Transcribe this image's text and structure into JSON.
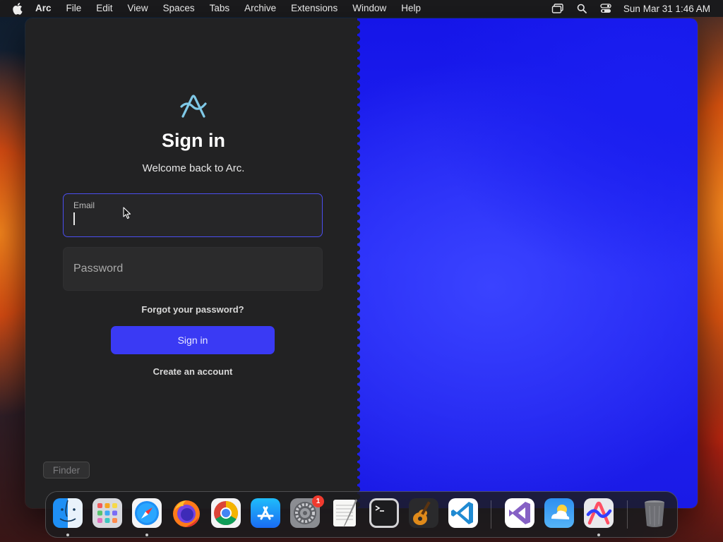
{
  "menubar": {
    "app_name": "Arc",
    "items": [
      "File",
      "Edit",
      "View",
      "Spaces",
      "Tabs",
      "Archive",
      "Extensions",
      "Window",
      "Help"
    ],
    "clock": "Sun Mar 31  1:46 AM",
    "tray_icons": [
      "screen-mirroring-icon",
      "spotlight-search-icon",
      "control-center-icon"
    ]
  },
  "signin": {
    "title": "Sign in",
    "subtitle": "Welcome back to Arc.",
    "email_label": "Email",
    "email_value": "",
    "password_placeholder": "Password",
    "forgot_link": "Forgot your password?",
    "submit_label": "Sign in",
    "create_link": "Create an account"
  },
  "tooltip": {
    "text": "Finder"
  },
  "dock": {
    "apps": [
      {
        "name": "Finder",
        "icon": "finder-icon",
        "running": true
      },
      {
        "name": "Launchpad",
        "icon": "launchpad-icon",
        "running": false
      },
      {
        "name": "Safari",
        "icon": "safari-icon",
        "running": true
      },
      {
        "name": "Firefox",
        "icon": "firefox-icon",
        "running": false
      },
      {
        "name": "Google Chrome",
        "icon": "chrome-icon",
        "running": false
      },
      {
        "name": "App Store",
        "icon": "app-store-icon",
        "running": false
      },
      {
        "name": "System Settings",
        "icon": "system-settings-icon",
        "running": false,
        "badge": "1"
      },
      {
        "name": "TextEdit",
        "icon": "textedit-icon",
        "running": false
      },
      {
        "name": "Terminal",
        "icon": "terminal-icon",
        "running": false
      },
      {
        "name": "GarageBand",
        "icon": "garageband-icon",
        "running": false
      },
      {
        "name": "Visual Studio Code",
        "icon": "vscode-icon",
        "running": false
      },
      {
        "name": "Visual Studio",
        "icon": "visual-studio-icon",
        "running": false
      },
      {
        "name": "Weather",
        "icon": "weather-icon",
        "running": false
      },
      {
        "name": "Arc",
        "icon": "arc-icon",
        "running": true
      },
      {
        "name": "Trash",
        "icon": "trash-icon",
        "running": false
      }
    ]
  },
  "colors": {
    "accent": "#3a3af4",
    "field_focus_border": "#4b4ef0",
    "window_bg": "#222223",
    "panel_blue": "#2326f5"
  }
}
